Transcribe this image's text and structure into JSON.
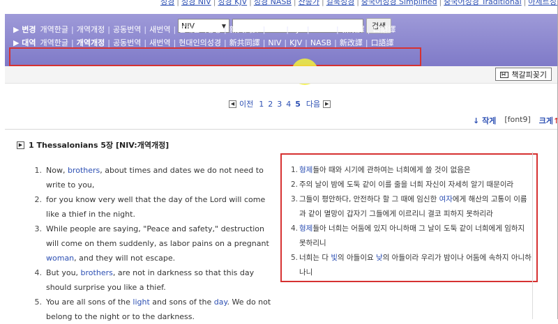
{
  "top_links": [
    "성경",
    "성경 NIV",
    "성경 KJV",
    "성경 NASB",
    "찬송가",
    "킬북성경",
    "중국어성경 Simplified",
    "중국어성경 Traditional",
    "아제르성경"
  ],
  "search": {
    "version_selected": "NIV",
    "query": "",
    "button_label": "검색"
  },
  "version_rows": [
    {
      "head": "변경",
      "items": [
        {
          "label": "개역한글",
          "bold": false
        },
        {
          "label": "개역개정",
          "bold": false
        },
        {
          "label": "공동번역",
          "bold": false
        },
        {
          "label": "새번역",
          "bold": false
        },
        {
          "label": "현대인의성경",
          "bold": false
        },
        {
          "label": "新共同譯",
          "bold": false
        },
        {
          "label": "NIV",
          "bold": true
        },
        {
          "label": "KJV",
          "bold": false
        },
        {
          "label": "NASB",
          "bold": false
        },
        {
          "label": "新改譯",
          "bold": false
        },
        {
          "label": "口語譯",
          "bold": false
        }
      ]
    },
    {
      "head": "대역",
      "items": [
        {
          "label": "개역한글",
          "bold": false
        },
        {
          "label": "개역개정",
          "bold": true
        },
        {
          "label": "공동번역",
          "bold": false
        },
        {
          "label": "새번역",
          "bold": false
        },
        {
          "label": "현대인의성경",
          "bold": false
        },
        {
          "label": "新共同譯",
          "bold": false
        },
        {
          "label": "NIV",
          "bold": false
        },
        {
          "label": "KJV",
          "bold": false
        },
        {
          "label": "NASB",
          "bold": false
        },
        {
          "label": "新改譯",
          "bold": false
        },
        {
          "label": "口語譯",
          "bold": false
        }
      ]
    }
  ],
  "bookmark_button": "책갈피꽂기",
  "pager": {
    "prev": "이전",
    "pages": [
      "1",
      "2",
      "3",
      "4",
      "5"
    ],
    "current": "5",
    "next": "다음"
  },
  "font_controls": {
    "smaller": "작게",
    "current": "[font9]",
    "bigger": "크게",
    "down_arrow": "↓",
    "up_arrow": "↑"
  },
  "chapter_title": "1 Thessalonians 5장 [NIV:개역개정]",
  "english_verses": [
    {
      "num": "1.",
      "parts": [
        [
          "Now, ",
          ""
        ],
        [
          "brothers",
          "hl"
        ],
        [
          ", about times and dates we do not need to write to you,",
          ""
        ]
      ]
    },
    {
      "num": "2.",
      "parts": [
        [
          "for you know very well that the day of the Lord will come like a thief in the night.",
          ""
        ]
      ]
    },
    {
      "num": "3.",
      "parts": [
        [
          "While people are saying, \"Peace and safety,\" destruction will come on them suddenly, as labor pains on a pregnant ",
          ""
        ],
        [
          "woman",
          "hl"
        ],
        [
          ", and they will not escape.",
          ""
        ]
      ]
    },
    {
      "num": "4.",
      "parts": [
        [
          "But you, ",
          ""
        ],
        [
          "brothers",
          "hl"
        ],
        [
          ", are not in darkness so that this day should surprise you like a thief.",
          ""
        ]
      ]
    },
    {
      "num": "5.",
      "parts": [
        [
          "You are all sons of the ",
          ""
        ],
        [
          "light",
          "hl"
        ],
        [
          " and sons of the ",
          ""
        ],
        [
          "day",
          "hl"
        ],
        [
          ". We do not belong to the night or to the darkness.",
          ""
        ]
      ]
    }
  ],
  "korean_verses": [
    {
      "num": "1.",
      "parts": [
        [
          "형제",
          "hl"
        ],
        [
          "들아 때와 시기에 관하여는 너희에게 쓸 것이 없음은",
          ""
        ]
      ]
    },
    {
      "num": "2.",
      "parts": [
        [
          "주의 날이 밤에 도둑 같이 이를 줄을 너희 자신이 자세히 알기 때문이라",
          ""
        ]
      ]
    },
    {
      "num": "3.",
      "parts": [
        [
          "그들이 평안하다, 안전하다 할 그 때에 임신한 ",
          ""
        ],
        [
          "여자",
          "hl"
        ],
        [
          "에게 해산의 고통이 이름과 같이 멸망이 갑자기 그들에게 이르리니 결코 피하지 못하리라",
          ""
        ]
      ]
    },
    {
      "num": "4.",
      "parts": [
        [
          "형제",
          "hl"
        ],
        [
          "들아 너희는 어둠에 있지 아니하매 그 날이 도둑 같이 너희에게 임하지 못하리니",
          ""
        ]
      ]
    },
    {
      "num": "5.",
      "parts": [
        [
          "너희는 다 ",
          ""
        ],
        [
          "빛",
          "hl"
        ],
        [
          "의 아들이요 ",
          ""
        ],
        [
          "낮",
          "hl"
        ],
        [
          "의 아들이라 우리가 밤이나 어둠에 속하지 아니하나니",
          ""
        ]
      ]
    }
  ],
  "colors": {
    "purple_top": "#9e9ad8",
    "purple_bottom": "#7f7ac8",
    "link": "#2c4fb3",
    "annotation_red": "#d63131",
    "cursor_highlight": "#f3f03c"
  }
}
